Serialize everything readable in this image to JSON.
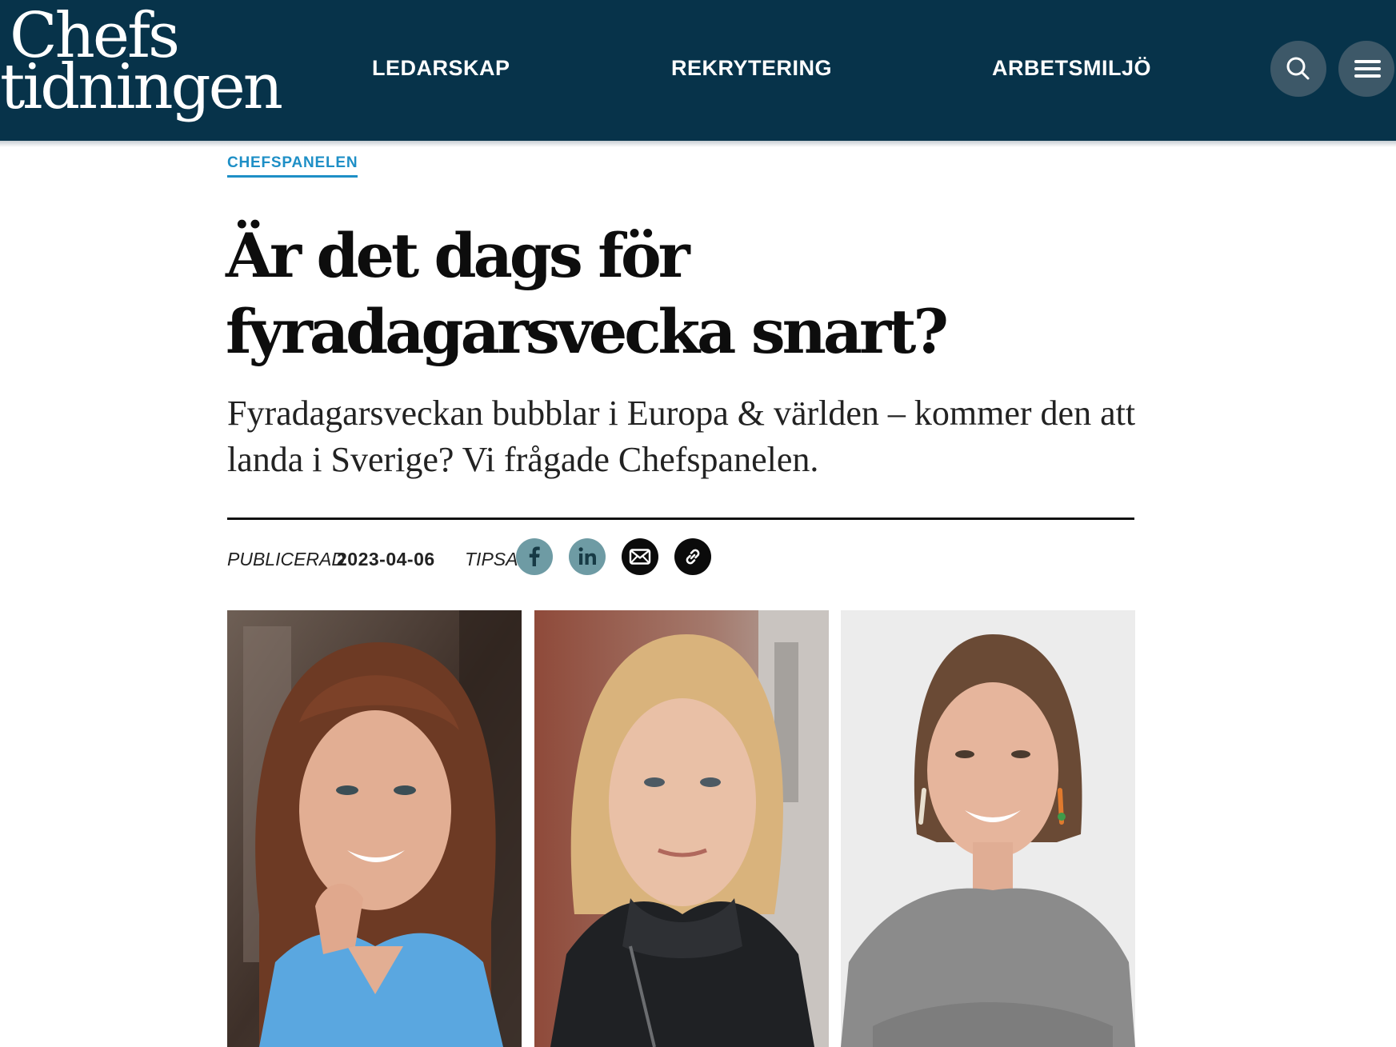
{
  "header": {
    "logo_line1": "Chefs",
    "logo_line2": "tidningen",
    "nav": [
      "LEDARSKAP",
      "REKRYTERING",
      "ARBETSMILJÖ"
    ],
    "search_icon": "search-icon",
    "menu_icon": "hamburger-menu-icon",
    "background_color": "#07334a"
  },
  "article": {
    "category": "CHEFSPANELEN",
    "headline_line1": "Är det dags för",
    "headline_line2": "fyradagarsvecka snart?",
    "lead": "Fyradagarsveckan bubblar i Europa & världen – kommer den att landa i Sverige? Vi frågade Chefspanelen.",
    "published_label": "PUBLICERAD",
    "published_date": "2023-04-06",
    "share_label": "TIPSA",
    "share_icons": [
      "facebook-icon",
      "linkedin-icon",
      "email-icon",
      "link-icon"
    ],
    "accent_color": "#1e8fc6"
  },
  "photos": [
    {
      "name": "panelist-photo-1"
    },
    {
      "name": "panelist-photo-2"
    },
    {
      "name": "panelist-photo-3"
    }
  ]
}
